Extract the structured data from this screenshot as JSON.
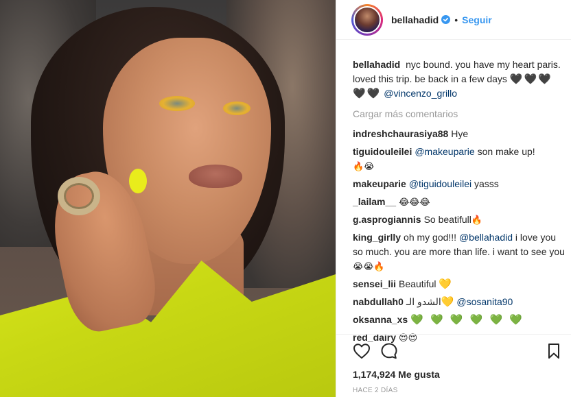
{
  "post": {
    "image_alt": "Photo",
    "header": {
      "username": "bellahadid",
      "separator": "•",
      "follow_label": "Seguir"
    },
    "caption": {
      "user": "bellahadid",
      "text": "nyc bound. you have my heart paris. loved this trip. be back in a few days",
      "hearts": "🖤🖤🖤🖤🖤",
      "mention": "@vincenzo_grillo"
    },
    "load_more_label": "Cargar más comentarios",
    "comments": [
      {
        "user": "indreshchaurasiya88",
        "text": "Hye"
      },
      {
        "user": "tiguidouleilei",
        "mention": "@makeuparie",
        "text": " son make up!",
        "emoji": "🔥😭"
      },
      {
        "user": "makeuparie",
        "mention": "@tiguidouleilei",
        "text": " yasss"
      },
      {
        "user": "_lailam__",
        "emoji": "😂😂😂"
      },
      {
        "user": "g.asprogiannis",
        "text": "So beatifull",
        "emoji": "🔥"
      },
      {
        "user": "king_girlly",
        "text": "oh my god!!! ",
        "mention": "@bellahadid",
        "text2": " i love you so much. you are more than life. i want to see you",
        "emoji": "😭😭🔥"
      },
      {
        "user": "sensei_lii",
        "text": "Beautiful ",
        "emoji": "💛"
      },
      {
        "user": "nabdullah0",
        "text": "الشدو الـ",
        "emoji": "💛",
        "mention": "@sosanita90"
      },
      {
        "user": "oksanna_xs",
        "emoji": "💚 💚 💚 💚 💚 💚"
      },
      {
        "user": "red_dairy",
        "emoji": "😍😍"
      }
    ],
    "actions": {
      "like_icon": "heart-outline-icon",
      "comment_icon": "comment-bubble-icon",
      "save_icon": "bookmark-icon"
    },
    "likes_label": "1,174,924 Me gusta",
    "date_label": "HACE 2 DÍAS",
    "colors": {
      "link": "#3897f0",
      "mention": "#003569",
      "muted": "#999999",
      "text": "#262626"
    }
  }
}
